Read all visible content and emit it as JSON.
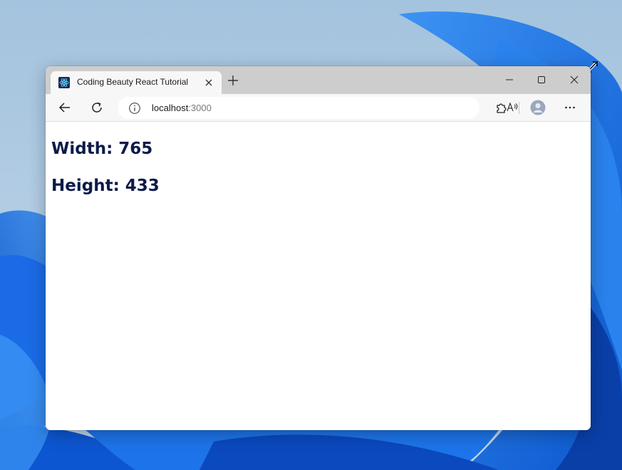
{
  "browser": {
    "tab": {
      "title": "Coding Beauty React Tutorial",
      "favicon": "react-logo-icon"
    },
    "address_bar": {
      "host": "localhost",
      "port": ":3000"
    },
    "icons": [
      "back-arrow-icon",
      "refresh-icon",
      "info-icon",
      "read-aloud-icon",
      "favorites-star-icon",
      "extensions-icon",
      "profile-avatar",
      "more-icon"
    ]
  },
  "page": {
    "width_label": "Width: 765",
    "height_label": "Height: 433"
  },
  "colors": {
    "heading": "#0d1a4a",
    "tab_strip": "#cdcdcd",
    "toolbar": "#f7f7f7",
    "wallpaper_blue": "#1a6fe0"
  }
}
